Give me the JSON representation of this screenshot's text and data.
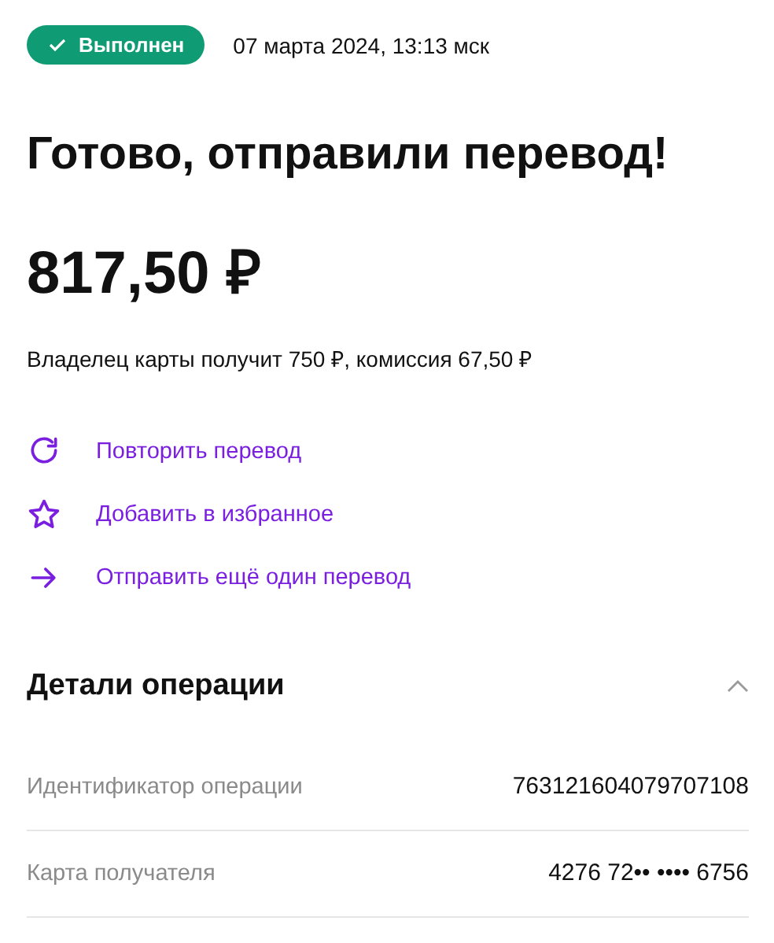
{
  "status": {
    "label": "Выполнен",
    "date": "07 марта 2024, 13:13 мск"
  },
  "title": "Готово, отправили перевод!",
  "amount": "817,50 ₽",
  "note": "Владелец карты получит 750 ₽, комиссия 67,50 ₽",
  "actions": [
    {
      "kind": "repeat",
      "label": "Повторить перевод"
    },
    {
      "kind": "favorite",
      "label": "Добавить в избранное"
    },
    {
      "kind": "send",
      "label": "Отправить ещё один перевод"
    }
  ],
  "details": {
    "title": "Детали операции",
    "expanded": true,
    "rows": [
      {
        "label": "Идентификатор операции",
        "value": "763121604079707108"
      },
      {
        "label": "Карта получателя",
        "value": "4276 72•• •••• 6756"
      }
    ]
  }
}
